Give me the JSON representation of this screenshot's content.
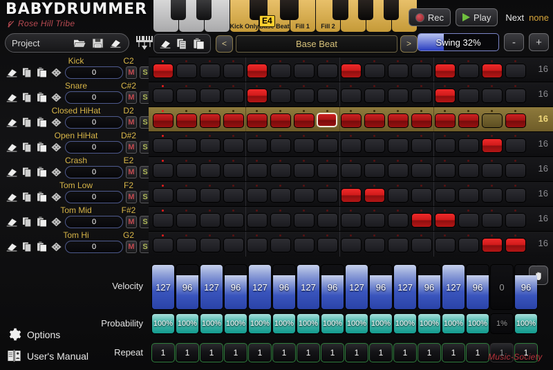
{
  "app": {
    "title": "BABYDRUMMER",
    "subtitle": "Rose Hill Tribe",
    "watermark": "Music-Society"
  },
  "project_bar": {
    "label": "Project",
    "open_icon": "folder-open-icon",
    "save_icon": "floppy-save-icon",
    "erase_icon": "eraser-icon",
    "keyboard_icon": "midi-keyboard-icon"
  },
  "keyboard": {
    "tooltip": "E4",
    "keys": [
      {
        "label": "",
        "gold": false,
        "black": true
      },
      {
        "label": "",
        "gold": false,
        "black": true
      },
      {
        "label": "",
        "gold": false,
        "black": false
      },
      {
        "label": "Kick Only",
        "gold": true,
        "black": true
      },
      {
        "label": "Base Beat",
        "gold": true,
        "black": true
      },
      {
        "label": "Fill 1",
        "gold": true,
        "black": false
      },
      {
        "label": "Fill 2",
        "gold": true,
        "black": true
      },
      {
        "label": "",
        "gold": true,
        "black": true
      },
      {
        "label": "",
        "gold": true,
        "black": true
      },
      {
        "label": "",
        "gold": true,
        "black": false
      }
    ]
  },
  "transport": {
    "rec_label": "Rec",
    "rec_icon": "record-dot-icon",
    "play_label": "Play",
    "play_icon": "play-triangle-icon",
    "next_label": "Next",
    "next_value": "none"
  },
  "swing": {
    "label": "Swing 32%",
    "percent": 32,
    "minus_label": "-",
    "plus_label": "+"
  },
  "pattern_bar": {
    "erase_icon": "eraser-icon",
    "copy_icon": "copy-icon",
    "paste_icon": "paste-icon",
    "prev_label": "<",
    "next_label": ">",
    "name": "Base Beat"
  },
  "tracks": [
    {
      "name": "Kick",
      "note": "C2",
      "value": "0",
      "mute": "M",
      "solo": "S",
      "length": "16",
      "selected": false,
      "steps": [
        1,
        0,
        0,
        0,
        1,
        0,
        0,
        0,
        1,
        0,
        0,
        0,
        1,
        0,
        1,
        0
      ],
      "hover": -1
    },
    {
      "name": "Snare",
      "note": "C#2",
      "value": "0",
      "mute": "M",
      "solo": "S",
      "length": "16",
      "selected": false,
      "steps": [
        0,
        0,
        0,
        0,
        1,
        0,
        0,
        0,
        0,
        0,
        0,
        0,
        1,
        0,
        0,
        0
      ],
      "hover": -1
    },
    {
      "name": "Closed HiHat",
      "note": "D2",
      "value": "0",
      "mute": "M",
      "solo": "S",
      "length": "16",
      "selected": true,
      "steps": [
        1,
        1,
        1,
        1,
        1,
        1,
        1,
        1,
        1,
        1,
        1,
        1,
        1,
        1,
        0,
        1
      ],
      "hover": 7
    },
    {
      "name": "Open HiHat",
      "note": "D#2",
      "value": "0",
      "mute": "M",
      "solo": "S",
      "length": "16",
      "selected": false,
      "steps": [
        0,
        0,
        0,
        0,
        0,
        0,
        0,
        0,
        0,
        0,
        0,
        0,
        0,
        0,
        1,
        0
      ],
      "hover": -1
    },
    {
      "name": "Crash",
      "note": "E2",
      "value": "0",
      "mute": "M",
      "solo": "S",
      "length": "16",
      "selected": false,
      "steps": [
        0,
        0,
        0,
        0,
        0,
        0,
        0,
        0,
        0,
        0,
        0,
        0,
        0,
        0,
        0,
        0
      ],
      "hover": -1
    },
    {
      "name": "Tom Low",
      "note": "F2",
      "value": "0",
      "mute": "M",
      "solo": "S",
      "length": "16",
      "selected": false,
      "steps": [
        0,
        0,
        0,
        0,
        0,
        0,
        0,
        0,
        1,
        1,
        0,
        0,
        0,
        0,
        0,
        0
      ],
      "hover": -1
    },
    {
      "name": "Tom Mid",
      "note": "F#2",
      "value": "0",
      "mute": "M",
      "solo": "S",
      "length": "16",
      "selected": false,
      "steps": [
        0,
        0,
        0,
        0,
        0,
        0,
        0,
        0,
        0,
        0,
        0,
        1,
        1,
        0,
        0,
        0
      ],
      "hover": -1
    },
    {
      "name": "Tom Hi",
      "note": "G2",
      "value": "0",
      "mute": "M",
      "solo": "S",
      "length": "16",
      "selected": false,
      "steps": [
        0,
        0,
        0,
        0,
        0,
        0,
        0,
        0,
        0,
        0,
        0,
        0,
        0,
        0,
        1,
        1
      ],
      "hover": -1
    }
  ],
  "lanes": {
    "velocity": {
      "label": "Velocity",
      "max": 127,
      "values": [
        127,
        96,
        127,
        96,
        127,
        96,
        127,
        96,
        127,
        96,
        127,
        96,
        127,
        96,
        0,
        96
      ]
    },
    "probability": {
      "label": "Probability",
      "values": [
        "100%",
        "100%",
        "100%",
        "100%",
        "100%",
        "100%",
        "100%",
        "100%",
        "100%",
        "100%",
        "100%",
        "100%",
        "100%",
        "100%",
        "1%",
        "100%"
      ],
      "percents": [
        100,
        100,
        100,
        100,
        100,
        100,
        100,
        100,
        100,
        100,
        100,
        100,
        100,
        100,
        1,
        100
      ]
    },
    "repeat": {
      "label": "Repeat",
      "values": [
        "1",
        "1",
        "1",
        "1",
        "1",
        "1",
        "1",
        "1",
        "1",
        "1",
        "1",
        "1",
        "1",
        "1",
        "1",
        "1"
      ]
    },
    "hand_icon": "hand-grab-icon"
  },
  "footer": {
    "options_label": "Options",
    "options_icon": "gear-icon",
    "manual_label": "User's Manual",
    "manual_icon": "book-icon"
  },
  "colors": {
    "accent_gold": "#d8b648",
    "step_on": "#d01a1a",
    "velocity": "#3a55bd",
    "probability": "#139b8e",
    "repeat_border": "#2f7d3c",
    "brand_red": "#b94a52"
  }
}
